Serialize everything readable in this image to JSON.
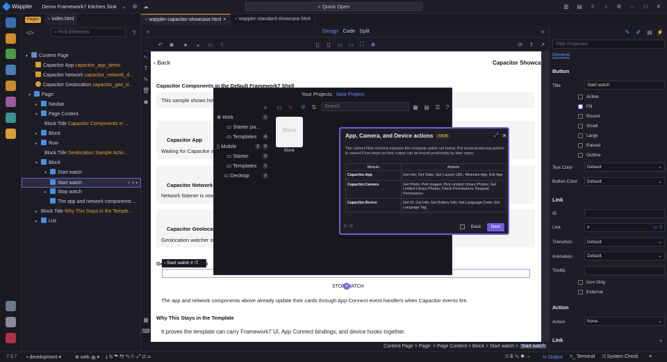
{
  "app": {
    "name": "Wappler",
    "project": "Demo Framework7 Kitchen Sink",
    "quick_open": "Quick Open"
  },
  "structure": {
    "tabs": [
      "Pages",
      "index.html"
    ],
    "filter_placeholder": "Find Elements",
    "tree": [
      {
        "label": "Content Page",
        "sub": ""
      },
      {
        "label": "Capacitor App",
        "sub": "capacitor_app_demo"
      },
      {
        "label": "Capacitor Network",
        "sub": "capacitor_network_d..."
      },
      {
        "label": "Capacitor Geolocation",
        "sub": "capacitor_geo_d..."
      },
      {
        "label": "Page:",
        "sub": ""
      },
      {
        "label": "Navbar",
        "sub": ""
      },
      {
        "label": "Page Content",
        "sub": ""
      },
      {
        "label": "Block Title",
        "sub": "Capacitor Components in ..."
      },
      {
        "label": "Block",
        "sub": ""
      },
      {
        "label": "Row",
        "sub": ""
      },
      {
        "label": "Block Title",
        "sub": "Geolocation Sample Actio..."
      },
      {
        "label": "Block",
        "sub": ""
      },
      {
        "label": "Start watch",
        "sub": ""
      },
      {
        "label": "Start watch",
        "sub": ""
      },
      {
        "label": "Stop watch",
        "sub": ""
      },
      {
        "label": "The app and network components ...",
        "sub": ""
      },
      {
        "label": "Block Title",
        "sub": "Why This Stays in the Temple..."
      },
      {
        "label": "List",
        "sub": ""
      }
    ]
  },
  "doc_tabs": [
    "wappler-capacitor-showcase.html",
    "wappler-standard-showcase.html"
  ],
  "modes": [
    "Design",
    "Code",
    "Split"
  ],
  "canvas": {
    "back": "Back",
    "nav_title": "Capacitor Showcase",
    "block_title_1": "Capacitor Components in the Default Framework7 Shell",
    "intro": "This sample shows how W",
    "app_title": "Capacitor App",
    "app_text": "Waiting for Capacitor app",
    "network_title": "Capacitor Network",
    "network_text": "Network listener is ready.",
    "geo_title": "Capacitor Geolocatio",
    "geo_text": "Geolocation watcher is idl",
    "geo_sample": "Ge",
    "geo_sample_tail": "Acti",
    "selected_chip": "Start watch #",
    "stop_watch": "STOP WATCH",
    "app_network_text": "The app and network components above already update their cards through App Connect event handlers when Capacitor events fire.",
    "why_title": "Why This Stays in the Template",
    "why_text": "It proves the template can carry Framework7 UI, App Connect bindings, and device hooks together."
  },
  "project_dialog": {
    "title": "Your Projects",
    "new_project": "New Project",
    "search_placeholder": "Search",
    "items": [
      {
        "label": "Web",
        "count": "1"
      },
      {
        "label": "Starter pa...",
        "count": ""
      },
      {
        "label": "Templates",
        "count": "4"
      },
      {
        "label": "Mobile",
        "count": "2"
      },
      {
        "label": "Starter",
        "count": "0"
      },
      {
        "label": "Templates",
        "count": "1"
      },
      {
        "label": "Desktop",
        "count": "2"
      }
    ],
    "mobile_extra": "6",
    "blank_card": "Blank",
    "blank_label": "Blank"
  },
  "tour": {
    "title": "App, Camera, and Device actions",
    "badge": "TOUR",
    "description": "The current Flow schema exposes the complete action set below. Put result-producing actions in named Flow steps so their output can be bound predictably by later steps.",
    "headers": [
      "Module",
      "Actions"
    ],
    "rows": [
      {
        "module": "Capacitor.App",
        "actions": "Get Info; Get State; Get Launch URL; Minimize App; Exit App"
      },
      {
        "module": "Capacitor.Camera",
        "actions": "Get Photo; Pick Images; Pick Limited Library Photos; Get Limited Library Photos; Check Permissions; Request Permissions"
      },
      {
        "module": "Capacitor.Device",
        "actions": "Get ID; Get Info; Get Battery Info; Get Language Code; Get Language Tag"
      }
    ],
    "progress": "9 / 11",
    "back": "Back",
    "next": "Next"
  },
  "props": {
    "filter_placeholder": "Filter Properties",
    "tab": "General",
    "section_button": "Button",
    "title_label": "Title",
    "title_value": "Start watch",
    "checks": [
      {
        "label": "Active",
        "on": false
      },
      {
        "label": "Fill",
        "on": true
      },
      {
        "label": "Round",
        "on": false
      },
      {
        "label": "Small",
        "on": false
      },
      {
        "label": "Large",
        "on": false
      },
      {
        "label": "Raised",
        "on": false
      },
      {
        "label": "Outline",
        "on": false
      }
    ],
    "text_color_label": "Text Color",
    "text_color_value": "Default",
    "button_color_label": "Button Color",
    "button_color_value": "Default",
    "section_link": "Link",
    "id_label": "ID",
    "link_label": "Link",
    "link_value": "#",
    "transition_label": "Transition",
    "transition_value": "Default",
    "animation_label": "Animation",
    "animation_value": "Default",
    "tooltip_label": "Tooltip",
    "icon_only": "Icon Only",
    "external": "External",
    "section_action": "Action",
    "action_label": "Action",
    "action_value": "None",
    "section_link2": "Link"
  },
  "breadcrumb": {
    "path": "Content Page > Page: > Page Content > Block > Start watch >",
    "current": "Start watch"
  },
  "status": {
    "version": "7.9.7",
    "env": "development",
    "target": "web",
    "target_count": "3",
    "output": "Output",
    "terminal": "Terminal",
    "system_check": "System Check"
  },
  "colors": {
    "accent": "#6e5ae0",
    "orange": "#e3a136",
    "blue": "#6e8cff"
  }
}
